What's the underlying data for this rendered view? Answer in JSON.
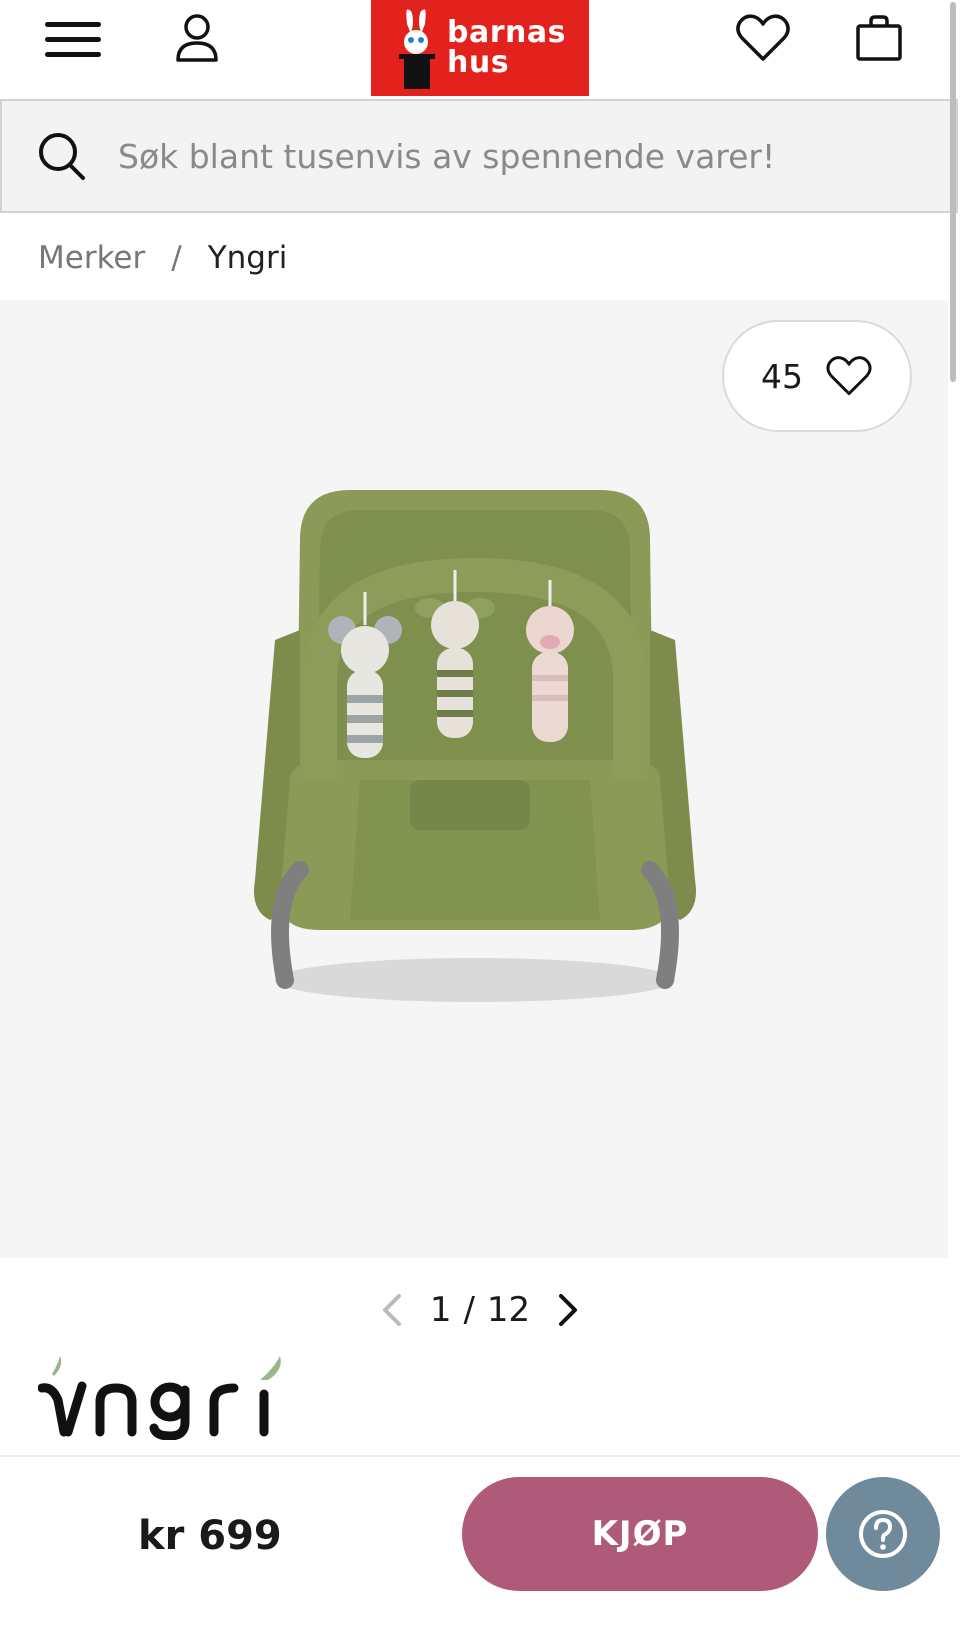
{
  "header": {
    "logo_line1": "barnas",
    "logo_line2": "hus",
    "menu_icon": "hamburger-menu-icon",
    "account_icon": "user-icon",
    "wishlist_icon": "heart-icon",
    "cart_icon": "shopping-bag-icon",
    "brand_color": "#e3221d"
  },
  "search": {
    "placeholder": "Søk blant tusenvis av spennende varer!",
    "icon": "search-icon"
  },
  "breadcrumb": {
    "items": [
      "Merker",
      "Yngri"
    ],
    "separator": "/"
  },
  "gallery": {
    "favorites_count": "45",
    "current": "1",
    "separator": "/",
    "total": "12",
    "background": "#f5f5f5"
  },
  "brand": {
    "name": "Yngri"
  },
  "purchase": {
    "price": "kr 699",
    "buy_label": "KJØP",
    "buy_color": "#b05a7a",
    "help_color": "#6f8b9b",
    "help_icon": "question-icon"
  }
}
